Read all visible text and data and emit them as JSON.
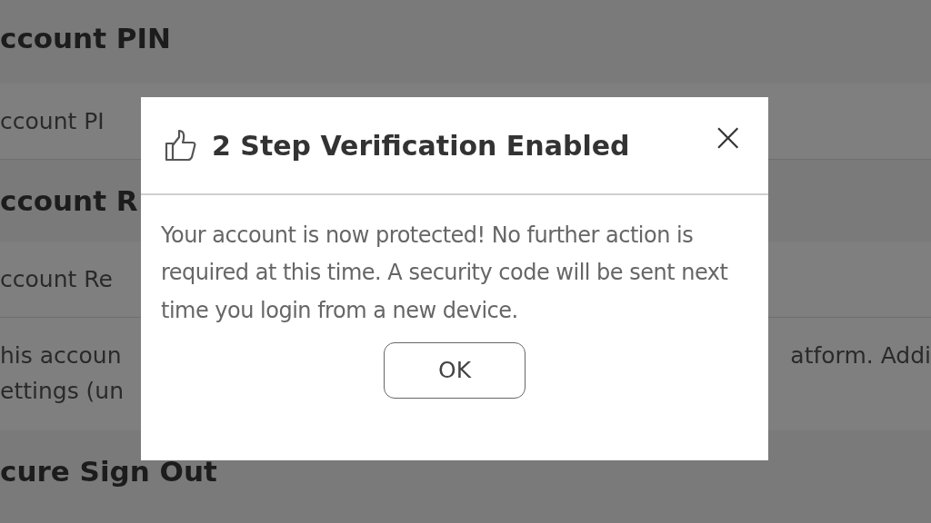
{
  "page": {
    "sections": [
      {
        "kind": "heading",
        "text": "ccount PIN"
      },
      {
        "kind": "row",
        "text": "ccount PI"
      },
      {
        "kind": "heading",
        "text": "ccount R"
      },
      {
        "kind": "row",
        "text": "ccount Re"
      },
      {
        "kind": "note",
        "lines": [
          "his accoun",
          "ettings (un"
        ],
        "right": "atform. Addi"
      },
      {
        "kind": "heading",
        "text": "cure Sign Out"
      }
    ]
  },
  "dialog": {
    "title": "2 Step Verification Enabled",
    "close": "×",
    "message": "Your account is now protected! No further action is required at this time. A security code will be sent next time you login from a new device.",
    "button": "OK"
  }
}
